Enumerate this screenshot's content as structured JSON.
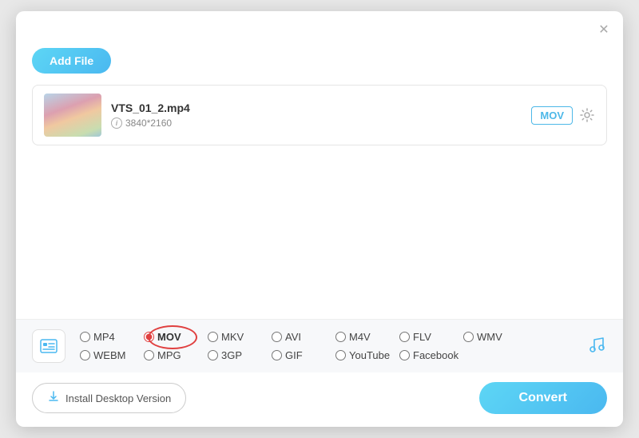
{
  "window": {
    "close_label": "✕"
  },
  "toolbar": {
    "add_file_label": "Add File"
  },
  "file": {
    "name": "VTS_01_2.mp4",
    "resolution": "3840*2160",
    "format_badge": "MOV"
  },
  "formats": {
    "options": [
      {
        "id": "mp4",
        "label": "MP4",
        "row": 0,
        "selected": false
      },
      {
        "id": "mov",
        "label": "MOV",
        "row": 0,
        "selected": true
      },
      {
        "id": "mkv",
        "label": "MKV",
        "row": 0,
        "selected": false
      },
      {
        "id": "avi",
        "label": "AVI",
        "row": 0,
        "selected": false
      },
      {
        "id": "m4v",
        "label": "M4V",
        "row": 0,
        "selected": false
      },
      {
        "id": "flv",
        "label": "FLV",
        "row": 0,
        "selected": false
      },
      {
        "id": "wmv",
        "label": "WMV",
        "row": 0,
        "selected": false
      },
      {
        "id": "webm",
        "label": "WEBM",
        "row": 1,
        "selected": false
      },
      {
        "id": "mpg",
        "label": "MPG",
        "row": 1,
        "selected": false
      },
      {
        "id": "3gp",
        "label": "3GP",
        "row": 1,
        "selected": false
      },
      {
        "id": "gif",
        "label": "GIF",
        "row": 1,
        "selected": false
      },
      {
        "id": "youtube",
        "label": "YouTube",
        "row": 1,
        "selected": false
      },
      {
        "id": "facebook",
        "label": "Facebook",
        "row": 1,
        "selected": false
      }
    ]
  },
  "bottom": {
    "install_label": "Install Desktop Version",
    "convert_label": "Convert"
  }
}
